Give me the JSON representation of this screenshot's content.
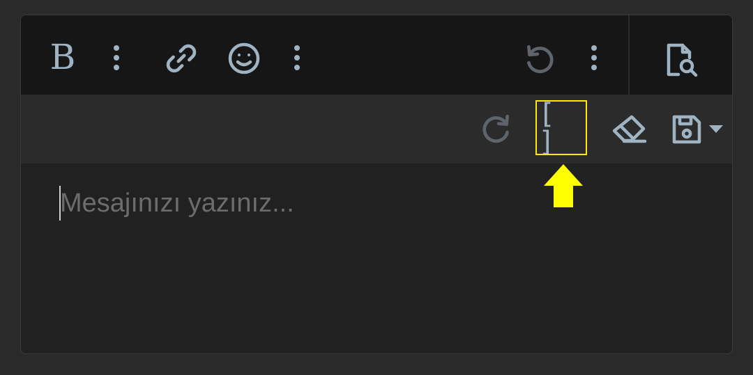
{
  "toolbar": {
    "bold_label": "B",
    "fullscreen_label": "[ ]",
    "items": [
      {
        "icon": "bold-icon",
        "enabled": true
      },
      {
        "icon": "more-vertical-icon",
        "enabled": true
      },
      {
        "icon": "link-icon",
        "enabled": true
      },
      {
        "icon": "emoji-smile-icon",
        "enabled": true
      },
      {
        "icon": "more-vertical-icon",
        "enabled": true
      },
      {
        "icon": "undo-icon",
        "enabled": false
      },
      {
        "icon": "more-vertical-icon",
        "enabled": true
      },
      {
        "icon": "preview-icon",
        "enabled": true
      },
      {
        "icon": "redo-icon",
        "enabled": false
      },
      {
        "icon": "fullscreen-brackets-icon",
        "enabled": true,
        "highlighted": true
      },
      {
        "icon": "eraser-icon",
        "enabled": true
      },
      {
        "icon": "save-draft-icon",
        "enabled": true
      },
      {
        "icon": "caret-down-icon",
        "enabled": true
      }
    ]
  },
  "editor": {
    "placeholder": "Mesajınızı yazınız..."
  },
  "annotation": {
    "highlight_color": "#ffea00",
    "arrow_color": "#ffff00"
  },
  "colors": {
    "icon": "#9fb3c2",
    "icon_disabled": "#5e6469",
    "toolbar_top_bg": "#161616",
    "toolbar_bottom_bg": "#2b2b2b",
    "editor_bg": "#212121",
    "page_bg": "#2a2a2a"
  }
}
